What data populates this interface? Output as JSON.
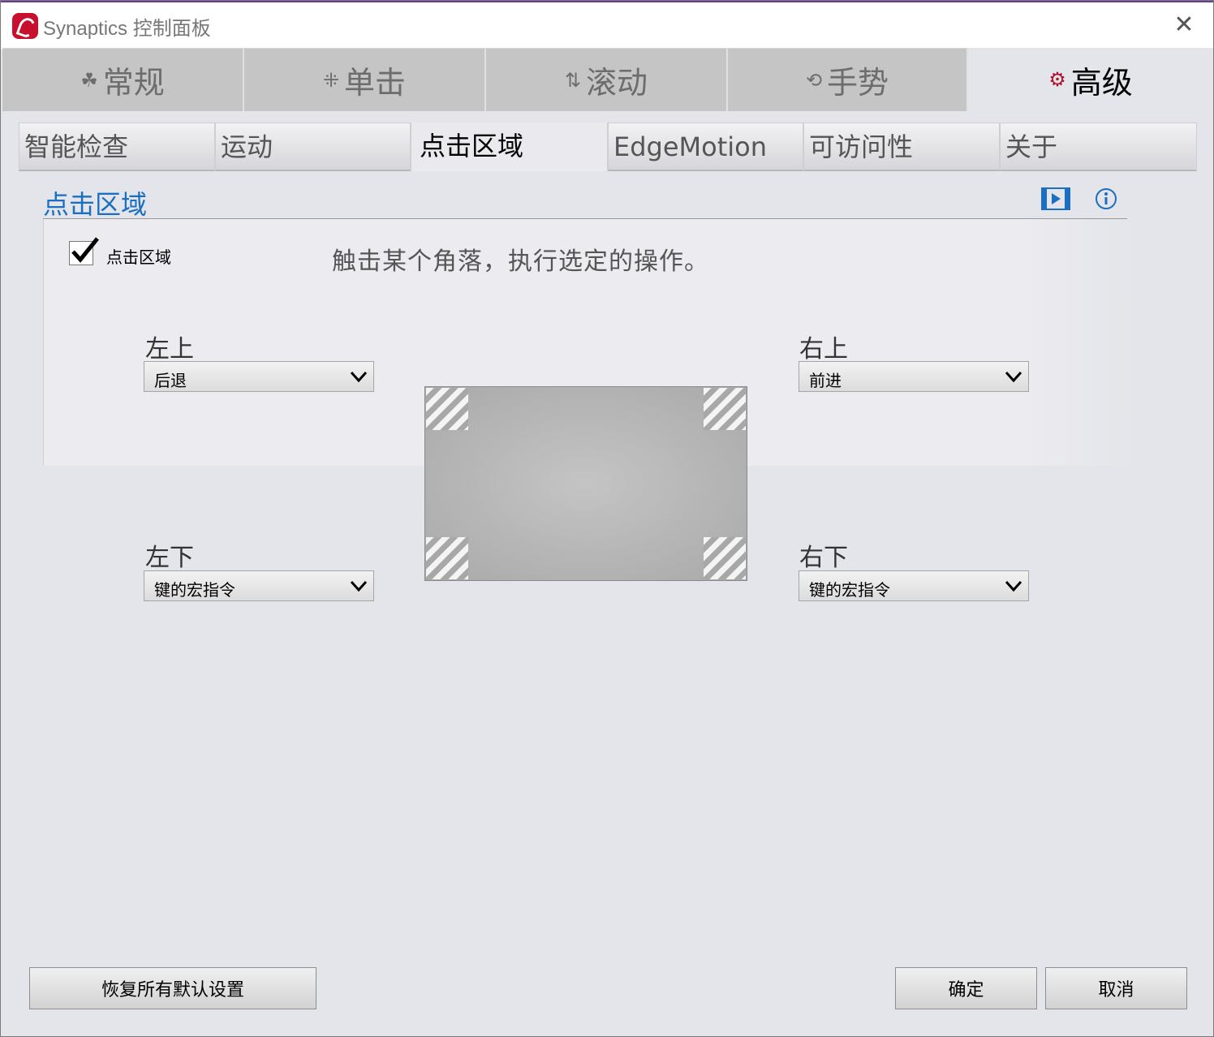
{
  "window": {
    "title": "Synaptics 控制面板",
    "close_glyph": "✕"
  },
  "main_tabs": [
    {
      "label": "常规",
      "icon": "leaf-icon",
      "glyph": "☘"
    },
    {
      "label": "单击",
      "icon": "click-icon",
      "glyph": "⁜"
    },
    {
      "label": "滚动",
      "icon": "scroll-arrows-icon",
      "glyph": "⇅"
    },
    {
      "label": "手势",
      "icon": "gesture-icon",
      "glyph": "⟲"
    },
    {
      "label": "高级",
      "icon": "gear-icon",
      "glyph": "⚙",
      "active": true
    }
  ],
  "sub_tabs": [
    {
      "label": "智能检查"
    },
    {
      "label": "运动"
    },
    {
      "label": "点击区域",
      "active": true
    },
    {
      "label": "EdgeMotion"
    },
    {
      "label": "可访问性"
    },
    {
      "label": "关于"
    }
  ],
  "section": {
    "title": "点击区域",
    "checkbox_label": "点击区域",
    "checkbox_checked": true,
    "description": "触击某个角落，执行选定的操作。"
  },
  "corners": {
    "top_left": {
      "label": "左上",
      "value": "后退"
    },
    "top_right": {
      "label": "右上",
      "value": "前进"
    },
    "bottom_left": {
      "label": "左下",
      "value": "键的宏指令"
    },
    "bottom_right": {
      "label": "右下",
      "value": "键的宏指令"
    }
  },
  "buttons": {
    "restore_defaults": "恢复所有默认设置",
    "ok": "确定",
    "cancel": "取消"
  },
  "colors": {
    "accent": "#1a6fc0",
    "brand_red": "#c8102e",
    "tab_inactive": "#c5c5c5"
  }
}
